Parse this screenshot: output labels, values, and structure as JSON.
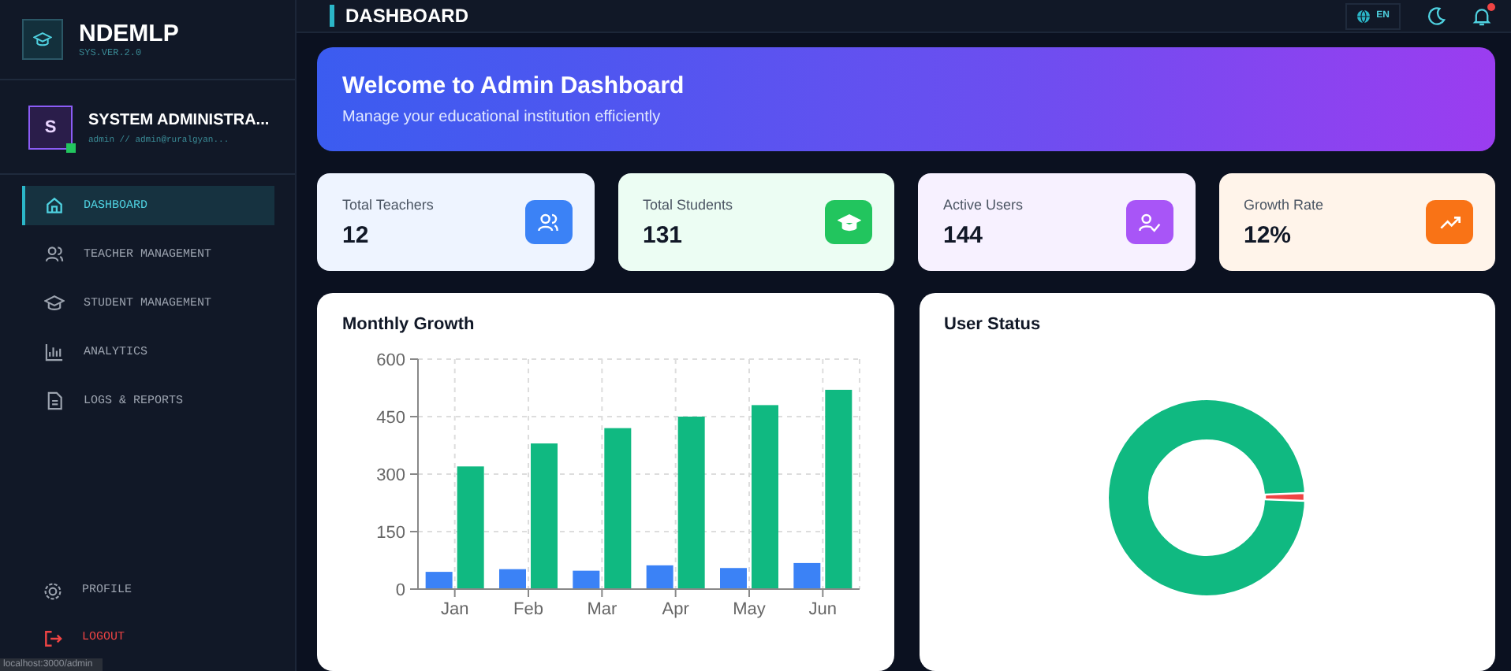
{
  "brand": {
    "title": "NDEMLP",
    "version": "SYS.VER.2.0"
  },
  "user": {
    "initial": "S",
    "name": "SYSTEM ADMINISTRA...",
    "email": "admin // admin@ruralgyan...",
    "online": true
  },
  "nav": [
    {
      "label": "DASHBOARD",
      "selected": true
    },
    {
      "label": "TEACHER MANAGEMENT",
      "selected": false
    },
    {
      "label": "STUDENT MANAGEMENT",
      "selected": false
    },
    {
      "label": "ANALYTICS",
      "selected": false
    },
    {
      "label": "LOGS & REPORTS",
      "selected": false
    }
  ],
  "footer_nav": [
    {
      "label": "PROFILE",
      "kind": "normal"
    },
    {
      "label": "LOGOUT",
      "kind": "danger"
    }
  ],
  "status_url": "localhost:3000/admin",
  "topbar": {
    "title": "DASHBOARD",
    "language": "EN",
    "has_notification": true
  },
  "banner": {
    "title": "Welcome to Admin Dashboard",
    "subtitle": "Manage your educational institution efficiently"
  },
  "stats": [
    {
      "label": "Total Teachers",
      "value": "12",
      "color": "#3b82f6"
    },
    {
      "label": "Total Students",
      "value": "131",
      "color": "#22c55e"
    },
    {
      "label": "Active Users",
      "value": "144",
      "color": "#a855f7"
    },
    {
      "label": "Growth Rate",
      "value": "12%",
      "color": "#f97316"
    }
  ],
  "growth_panel": {
    "title": "Monthly Growth",
    "chart_data": {
      "type": "bar",
      "categories": [
        "Jan",
        "Feb",
        "Mar",
        "Apr",
        "May",
        "Jun"
      ],
      "series": [
        {
          "color": "#3b82f6",
          "values": [
            45,
            52,
            48,
            62,
            55,
            68
          ]
        },
        {
          "color": "#10b981",
          "values": [
            320,
            380,
            420,
            450,
            480,
            520
          ]
        }
      ],
      "ylim": [
        0,
        600
      ],
      "yticks": [
        0,
        150,
        300,
        450,
        600
      ],
      "grid": true
    }
  },
  "status_panel": {
    "title": "User Status"
  }
}
